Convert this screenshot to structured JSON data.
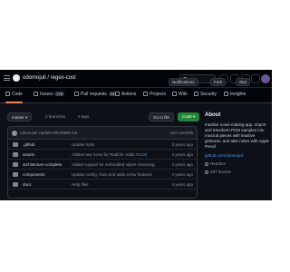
{
  "header": {
    "repo_path": "odomojuli / regex-cost",
    "search_icon": "search-icon",
    "avatar_color": "#6e5494"
  },
  "repo_actions": {
    "notifications": "Notifications",
    "fork": "Fork",
    "star": "Star"
  },
  "tabs": [
    {
      "label": "Code",
      "icon": "code-icon",
      "active": true
    },
    {
      "label": "Issues",
      "icon": "issue-icon",
      "count": "178"
    },
    {
      "label": "Pull requests",
      "icon": "pull-request-icon",
      "count": "34"
    },
    {
      "label": "Actions",
      "icon": "play-icon"
    },
    {
      "label": "Projects",
      "icon": "table-icon"
    },
    {
      "label": "Wiki",
      "icon": "book-icon"
    },
    {
      "label": "Security",
      "icon": "shield-icon"
    },
    {
      "label": "Insights",
      "icon": "graph-icon"
    }
  ],
  "branch": {
    "name": "master",
    "branches": "3 branches",
    "tags": "0 tags",
    "goto_file": "Go to file",
    "code_label": "Code"
  },
  "latest_commit": {
    "author": "odomojuli",
    "message": "Update README.md",
    "hash": "3a1b2c",
    "date": "on Feb 5, 2021",
    "count": "163 commits"
  },
  "files": [
    {
      "name": ".github",
      "message": "Update fonts",
      "link": "",
      "date": "3 years ago"
    },
    {
      "name": "assets",
      "message": "Added new icons for Radicle. Adds",
      "link": "#1234",
      "date": "4 years ago"
    },
    {
      "name": "architecture-complete",
      "message": "Added support for embedded object renaming.",
      "link": "",
      "date": "4 years ago"
    },
    {
      "name": "components",
      "message": "Update config, fixes and adds a few features",
      "link": "",
      "date": "4 years ago"
    },
    {
      "name": "docs",
      "message": "Help files",
      "link": "",
      "date": "4 years ago"
    }
  ],
  "about": {
    "title": "About",
    "description": "Intuitive noise-making app. Import and transform PCM samples into musical pieces with intuitive gestures, and take notes with Apple Pencil",
    "link": "github.com/odomojuli",
    "readme": "Readme",
    "license": "MIT license",
    "stars": "Stars"
  },
  "colors": {
    "accent": "#238636",
    "link": "#4493f8",
    "active_tab": "#f78166"
  }
}
